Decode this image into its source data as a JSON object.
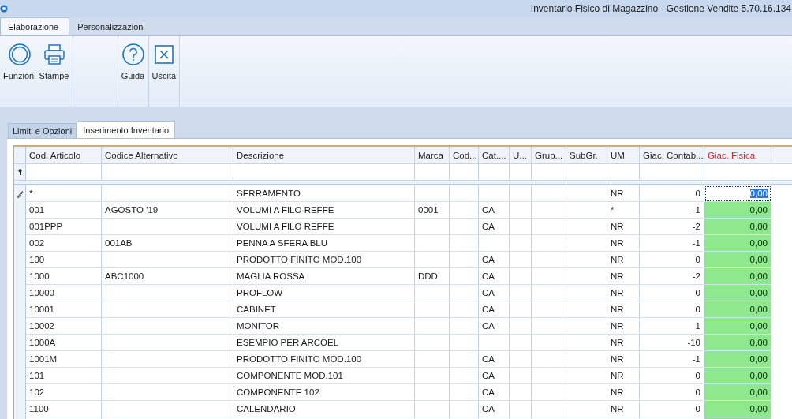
{
  "window": {
    "title": "Inventario Fisico di Magazzino - Gestione Vendite 5.70.16.134"
  },
  "ribbon_tabs": [
    {
      "label": "Elaborazione",
      "selected": true
    },
    {
      "label": "Personalizzazioni",
      "selected": false
    }
  ],
  "ribbon_buttons": [
    {
      "label": "Funzioni"
    },
    {
      "label": "Stampe"
    },
    {
      "label": "Guida"
    },
    {
      "label": "Uscita"
    }
  ],
  "page_tabs": [
    {
      "label": "Limiti e Opzioni",
      "selected": false
    },
    {
      "label": "Inserimento Inventario",
      "selected": true
    }
  ],
  "table": {
    "columns": [
      {
        "label": "Cod. Articolo",
        "highlight": false
      },
      {
        "label": "Codice Alternativo",
        "highlight": false
      },
      {
        "label": "Descrizione",
        "highlight": false
      },
      {
        "label": "Marca",
        "highlight": false
      },
      {
        "label": "Cod...",
        "highlight": false
      },
      {
        "label": "Cat....",
        "highlight": false
      },
      {
        "label": "U...",
        "highlight": false
      },
      {
        "label": "Grup...",
        "highlight": false
      },
      {
        "label": "SubGr.",
        "highlight": false
      },
      {
        "label": "UM",
        "highlight": false
      },
      {
        "label": "Giac. Contab...",
        "highlight": false
      },
      {
        "label": "Giac. Fisica",
        "highlight": true
      }
    ],
    "rows": [
      {
        "editing": true,
        "cells": [
          "*",
          "",
          "SERRAMENTO",
          "",
          "",
          "",
          "",
          "",
          "",
          "NR",
          "0",
          "0,00"
        ]
      },
      {
        "editing": false,
        "cells": [
          "001",
          "AGOSTO '19",
          "VOLUMI A FILO REFFE",
          "0001",
          "",
          "CA",
          "",
          "",
          "",
          "*",
          "-1",
          "0,00"
        ]
      },
      {
        "editing": false,
        "cells": [
          "001PPP",
          "",
          "VOLUMI A FILO REFFE",
          "",
          "",
          "CA",
          "",
          "",
          "",
          "NR",
          "-2",
          "0,00"
        ]
      },
      {
        "editing": false,
        "cells": [
          "002",
          "001AB",
          "PENNA A SFERA BLU",
          "",
          "",
          "",
          "",
          "",
          "",
          "NR",
          "-1",
          "0,00"
        ]
      },
      {
        "editing": false,
        "cells": [
          "100",
          "",
          "PRODOTTO FINITO MOD.100",
          "",
          "",
          "CA",
          "",
          "",
          "",
          "NR",
          "0",
          "0,00"
        ]
      },
      {
        "editing": false,
        "cells": [
          "1000",
          "ABC1000",
          "MAGLIA ROSSA",
          "DDD",
          "",
          "CA",
          "",
          "",
          "",
          "NR",
          "-2",
          "0,00"
        ]
      },
      {
        "editing": false,
        "cells": [
          "10000",
          "",
          "PROFLOW",
          "",
          "",
          "CA",
          "",
          "",
          "",
          "NR",
          "0",
          "0,00"
        ]
      },
      {
        "editing": false,
        "cells": [
          "10001",
          "",
          "CABINET",
          "",
          "",
          "CA",
          "",
          "",
          "",
          "NR",
          "0",
          "0,00"
        ]
      },
      {
        "editing": false,
        "cells": [
          "10002",
          "",
          "MONITOR",
          "",
          "",
          "CA",
          "",
          "",
          "",
          "NR",
          "1",
          "0,00"
        ]
      },
      {
        "editing": false,
        "cells": [
          "1000A",
          "",
          "ESEMPIO PER ARCOEL",
          "",
          "",
          "",
          "",
          "",
          "",
          "NR",
          "-10",
          "0,00"
        ]
      },
      {
        "editing": false,
        "cells": [
          "1001M",
          "",
          "PRODOTTO FINITO MOD.100",
          "",
          "",
          "CA",
          "",
          "",
          "",
          "NR",
          "-1",
          "0,00"
        ]
      },
      {
        "editing": false,
        "cells": [
          "101",
          "",
          "COMPONENTE MOD.101",
          "",
          "",
          "CA",
          "",
          "",
          "",
          "NR",
          "0",
          "0,00"
        ]
      },
      {
        "editing": false,
        "cells": [
          "102",
          "",
          "COMPONENTE 102",
          "",
          "",
          "CA",
          "",
          "",
          "",
          "NR",
          "0",
          "0,00"
        ]
      },
      {
        "editing": false,
        "cells": [
          "1100",
          "",
          "CALENDARIO",
          "",
          "",
          "CA",
          "",
          "",
          "",
          "NR",
          "0",
          "0,00"
        ]
      }
    ]
  }
}
